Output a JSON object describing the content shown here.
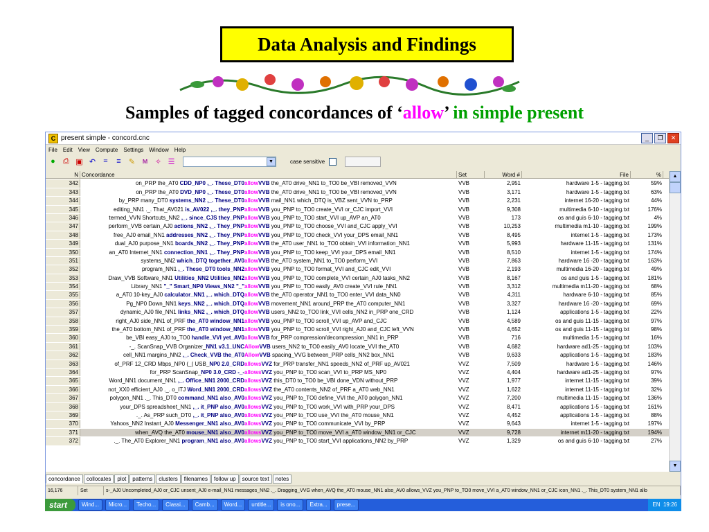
{
  "slide": {
    "title": "Data Analysis and Findings",
    "subtitle_pre": "Samples of tagged concordances of ‘",
    "subtitle_kw": "allow",
    "subtitle_mid": "’ ",
    "subtitle_tense": "in simple present"
  },
  "window": {
    "title": "present simple - concord.cnc",
    "menu": [
      "File",
      "Edit",
      "View",
      "Compute",
      "Settings",
      "Window",
      "Help"
    ],
    "case_sensitive_label": "case sensitive"
  },
  "columns": {
    "n": "N",
    "concordance": "Concordance",
    "set": "Set",
    "word": "Word #",
    "file": "File",
    "pct": "%"
  },
  "rows": [
    {
      "n": "342",
      "l": "on_PRP the_AT0 ",
      "node": "CDD_NP0 ,_. These_DT0 ",
      "kw": "allow",
      "tag": "VVB",
      "r": " the_AT0 drive_NN1 to_TO0 be_VBI removed_VVN",
      "set": "VVB",
      "word": "2,951",
      "file": "hardware 1-5 - tagging.txt",
      "pct": "59%"
    },
    {
      "n": "343",
      "l": "on_PRP the_AT0 ",
      "node": "DVD_NP0 ,_. These_DT0 ",
      "kw": "allow",
      "tag": "VVB",
      "r": " the_AT0 drive_NN1 to_TO0 be_VBI removed_VVN",
      "set": "VVB",
      "word": "3,171",
      "file": "hardware 1-5 - tagging.txt",
      "pct": "63%"
    },
    {
      "n": "344",
      "l": "by_PRP many_DT0 ",
      "node": "systems_NN2 ,_. These_DT0 ",
      "kw": "allow",
      "tag": "VVB",
      "r": " mail_NN1 which_DTQ is_VBZ sent_VVN to_PRP",
      "set": "VVB",
      "word": "2,231",
      "file": "internet 16-20 - tagging.txt",
      "pct": "44%"
    },
    {
      "n": "345",
      "l": "editing_NN1 ._. That_AV021 ",
      "node": "is_AV022 ,_. they_PNP ",
      "kw": "allow",
      "tag": "VVB",
      "r": " you_PNP to_TO0 create_VVI or_CJC import_VVI",
      "set": "VVB",
      "word": "9,308",
      "file": "multimedia 6-10 - tagging.txt",
      "pct": "176%"
    },
    {
      "n": "346",
      "l": "termed_VVN Shortcuts_NN2 ",
      "node": ",_. since_CJS they_PNP ",
      "kw": "allow",
      "tag": "VVB",
      "r": " you_PNP to_TO0 start_VVI up_AVP an_AT0",
      "set": "VVB",
      "word": "173",
      "file": "os and guis 6-10 - tagging.txt",
      "pct": "4%"
    },
    {
      "n": "347",
      "l": "perform_VVB certain_AJ0 ",
      "node": "actions_NN2 ,_. They_PNP ",
      "kw": "allow",
      "tag": "VVB",
      "r": " you_PNP to_TO0 choose_VVI and_CJC apply_VVI",
      "set": "VVB",
      "word": "10,253",
      "file": "multimedia m1-10 - tagging.txt",
      "pct": "199%"
    },
    {
      "n": "348",
      "l": "free_AJ0 email_NN1 ",
      "node": "addresses_NN2 ,_. They_PNP ",
      "kw": "allow",
      "tag": "VVB",
      "r": " you_PNP to_TO0 check_VVI your_DPS email_NN1",
      "set": "VVB",
      "word": "8,495",
      "file": "internet 1-5 - tagging.txt",
      "pct": "173%"
    },
    {
      "n": "349",
      "l": "dual_AJ0 purpose_NN1 ",
      "node": "boards_NN2 ,_. They_PNP ",
      "kw": "allow",
      "tag": "VVB",
      "r": " the_AT0 user_NN1 to_TO0 obtain_VVI information_NN1",
      "set": "VVB",
      "word": "5,993",
      "file": "hardware 11-15 - tagging.txt",
      "pct": "131%"
    },
    {
      "n": "350",
      "l": "an_AT0 Internet_NN1 ",
      "node": "connection_NN1 ,_. They_PNP ",
      "kw": "allow",
      "tag": "VVB",
      "r": " you_PNP to_TO0 keep_VVI your_DPS email_NN1",
      "set": "VVB",
      "word": "8,510",
      "file": "internet 1-5 - tagging.txt",
      "pct": "174%"
    },
    {
      "n": "351",
      "l": "systems_NN2 ",
      "node": "which_DTQ together_AV0 ",
      "kw": "allow",
      "tag": "VVB",
      "r": " the_AT0 system_NN1 to_TO0 perform_VVI",
      "set": "VVB",
      "word": "7,863",
      "file": "hardware 16 -20 - tagging.txt",
      "pct": "163%"
    },
    {
      "n": "352",
      "l": "program_NN1 ",
      "node": ",_. These_DT0 tools_NN2 ",
      "kw": "allow",
      "tag": "VVB",
      "r": " you_PNP to_TO0 format_VVI and_CJC edit_VVI",
      "set": "VVB",
      "word": "2,193",
      "file": "multimedia 16-20 - tagging.txt",
      "pct": "49%"
    },
    {
      "n": "353",
      "l": "Draw_VVB Software_NN1 ",
      "node": "Utilities_NN2 Utilities_NN2 ",
      "kw": "allow",
      "tag": "VVB",
      "r": " you_PNP to_TO0 complete_VVI certain_AJ0 tasks_NN2",
      "set": "VVB",
      "word": "8,167",
      "file": "os and guis 1-5 - tagging.txt",
      "pct": "181%"
    },
    {
      "n": "354",
      "l": "Library_NN1 ",
      "node": "\"_\" Smart_NP0 Views_NN2 \"_\" ",
      "kw": "allow",
      "tag": "VVB",
      "r": " you_PNP to_TO0 easily_AV0 create_VVI rule_NN1",
      "set": "VVB",
      "word": "3,312",
      "file": "multimedia m11-20 - tagging.txt",
      "pct": "68%"
    },
    {
      "n": "355",
      "l": "a_AT0 10-key_AJ0 ",
      "node": "calculator_NN1 ,_. which_DTQ ",
      "kw": "allow",
      "tag": "VVB",
      "r": " the_AT0 operator_NN1 to_TO0 enter_VVI data_NN0",
      "set": "VVB",
      "word": "4,311",
      "file": "hardware 6-10 - tagging.txt",
      "pct": "85%"
    },
    {
      "n": "356",
      "l": "Pg_NP0 Down_NN1 ",
      "node": "keys_NN2 ,_. which_DTQ ",
      "kw": "allow",
      "tag": "VVB",
      "r": " movement_NN1 around_PRP the_AT0 computer_NN1",
      "set": "VVB",
      "word": "3,327",
      "file": "hardware 16 -20 - tagging.txt",
      "pct": "69%"
    },
    {
      "n": "357",
      "l": "dynamic_AJ0 file_NN1 ",
      "node": "links_NN2 ,_. which_DTQ ",
      "kw": "allow",
      "tag": "VVB",
      "r": " users_NN2 to_TO0 link_VVI cells_NN2 in_PRP one_CRD",
      "set": "VVB",
      "word": "1,124",
      "file": "applications 1-5 - tagging.txt",
      "pct": "22%"
    },
    {
      "n": "358",
      "l": "right_AJ0 side_NN1 of_PRF ",
      "node": "the_AT0 window_NN1 ",
      "kw": "allow",
      "tag": "VVB",
      "r": " you_PNP to_TO0 scroll_VVI up_AVP and_CJC",
      "set": "VVB",
      "word": "4,589",
      "file": "os and guis 11-15 - tagging.txt",
      "pct": "97%"
    },
    {
      "n": "359",
      "l": "the_AT0 bottom_NN1 of_PRF ",
      "node": "the_AT0 window_NN1 ",
      "kw": "allow",
      "tag": "VVB",
      "r": " you_PNP to_TO0 scroll_VVI right_AJ0 and_CJC left_VVN",
      "set": "VVB",
      "word": "4,652",
      "file": "os and guis 11-15 - tagging.txt",
      "pct": "98%"
    },
    {
      "n": "360",
      "l": "be_VBI easy_AJ0 to_TO0 ",
      "node": "handle_VVI yet_AV0 ",
      "kw": "allow",
      "tag": "VVB",
      "r": " for_PRP compression/decompression_NN1 in_PRP",
      "set": "VVB",
      "word": "716",
      "file": "multimedia 1-5 - tagging.txt",
      "pct": "16%"
    },
    {
      "n": "361",
      "l": "-_. ScanSnap_VVB Organizer_",
      "node": "NN1 v3.1_UNC ",
      "kw": "Allow",
      "tag": "VVB",
      "r": " users_NN2 to_TO0 easily_AV0 locate_VVI the_AT0",
      "set": "VVB",
      "word": "4,682",
      "file": "hardware ad1-25 - tagging.txt",
      "pct": "103%"
    },
    {
      "n": "362",
      "l": "cell_NN1 margins_NN2 ",
      "node": ",_. Check_VVB the_AT0 ",
      "kw": "Allow",
      "tag": "VVB",
      "r": " spacing_VVG between_PRP cells_NN2 box_NN1",
      "set": "VVB",
      "word": "9,633",
      "file": "applications 1-5 - tagging.txt",
      "pct": "183%"
    },
    {
      "n": "363",
      "l": "of_PRF 12_CRD Mbps_NP0 (_( USB_",
      "node": "NP0 2.0_CRD ",
      "kw": "allows",
      "tag": "VVZ",
      "r": " for_PRP transfer_NN1 speeds_NN2 of_PRF up_AV021",
      "set": "VVZ",
      "word": "7,509",
      "file": "hardware 1-5 - tagging.txt",
      "pct": "146%"
    },
    {
      "n": "364",
      "l": "for_PRP ScanSnap_",
      "node": "NP0 3.0_CRD -_- ",
      "kw": "allows",
      "tag": "VVZ",
      "r": " you_PNP to_TO0 scan_VVI to_PRP MS_NP0",
      "set": "VVZ",
      "word": "4,404",
      "file": "hardware ad1-25 - tagging.txt",
      "pct": "97%"
    },
    {
      "n": "365",
      "l": "Word_NN1 document_NN1 ",
      "node": ",_. Office_NN1 2000_CRD ",
      "kw": "allows",
      "tag": "VVZ",
      "r": " this_DT0 to_TO0 be_VBI done_VDN without_PRP",
      "set": "VVZ",
      "word": "1,977",
      "file": "internet 11-15 - tagging.txt",
      "pct": "39%"
    },
    {
      "n": "366",
      "l": "not_XX0 efficient_AJ0 ._. o_ITJ ",
      "node": "Word_NN1 2000_CRD ",
      "kw": "allows",
      "tag": "VVZ",
      "r": " the_AT0 contents_NN2 of_PRF a_AT0 web_NN1",
      "set": "VVZ",
      "word": "1,622",
      "file": "internet 11-15 - tagging.txt",
      "pct": "32%"
    },
    {
      "n": "367",
      "l": "polygon_NN1 ._. This_DT0 ",
      "node": "command_NN1 also_AV0 ",
      "kw": "allows",
      "tag": "VVZ",
      "r": " you_PNP to_TO0 define_VVI the_AT0 polygon_NN1",
      "set": "VVZ",
      "word": "7,200",
      "file": "multimedia 11-15 - tagging.txt",
      "pct": "136%"
    },
    {
      "n": "368",
      "l": "your_DPS spreadsheet_NN1 ",
      "node": ",_. it_PNP also_AV0 ",
      "kw": "allows",
      "tag": "VVZ",
      "r": " you_PNP to_TO0 work_VVI with_PRP your_DPS",
      "set": "VVZ",
      "word": "8,471",
      "file": "applications 1-5 - tagging.txt",
      "pct": "161%"
    },
    {
      "n": "369",
      "l": "._. As_PRP such_DT0 ",
      "node": ",_. it_PNP also_AV0 ",
      "kw": "allows",
      "tag": "VVZ",
      "r": " you_PNP to_TO0 use_VVI the_AT0 mouse_NN1",
      "set": "VVZ",
      "word": "4,452",
      "file": "applications 1-5 - tagging.txt",
      "pct": "88%"
    },
    {
      "n": "370",
      "l": "Yahoos_NN2 Instant_AJ0 ",
      "node": "Messenger_NN1 also_AV0 ",
      "kw": "allows",
      "tag": "VVZ",
      "r": " you_PNP to_TO0 communicate_VVI by_PRP",
      "set": "VVZ",
      "word": "9,643",
      "file": "internet 1-5 - tagging.txt",
      "pct": "197%"
    },
    {
      "n": "371",
      "l": "when_AVQ the_AT0 ",
      "node": "mouse_NN1 also_AV0 ",
      "kw": "allows",
      "tag": "VVZ",
      "r": " you_PNP to_TO0 move_VVI a_AT0 window_NN1 or_CJC",
      "set": "VVZ",
      "word": "9,728",
      "file": "internet m11-20 - tagging.txt",
      "pct": "194%"
    },
    {
      "n": "372",
      "l": "._. The_AT0 Explorer_NN1 ",
      "node": "program_NN1 also_AV0 ",
      "kw": "allows",
      "tag": "VVZ",
      "r": " you_PNP to_TO0 start_VVI applications_NN2 by_PRP",
      "set": "VVZ",
      "word": "1,329",
      "file": "os and guis 6-10 - tagging.txt",
      "pct": "27%"
    }
  ],
  "tabs": [
    "concordance",
    "collocates",
    "plot",
    "patterns",
    "clusters",
    "filenames",
    "follow up",
    "source text",
    "notes"
  ],
  "status": {
    "count": "16,176",
    "set": "Set",
    "line": "s-_AJ0 Uncompleted_AJ0 or_CJC unsent_AJ0 e-mail_NN1 messages_NN2 ._. Dragging_VVG when_AVQ the_AT0 mouse_NN1 also_AV0 allows_VVZ you_PNP to_TO0 move_VVI a_AT0 window_NN1 or_CJC icon_NN1 ._. This_DT0 system_NN1 allo"
  },
  "taskbar": {
    "start": "start",
    "items": [
      "Wind...",
      "Micro...",
      "Techo...",
      "Classi...",
      "Camb...",
      "Word...",
      "untitle...",
      "is ono...",
      "Extra...",
      "prese..."
    ],
    "lang": "EN",
    "clock": "19:26"
  }
}
